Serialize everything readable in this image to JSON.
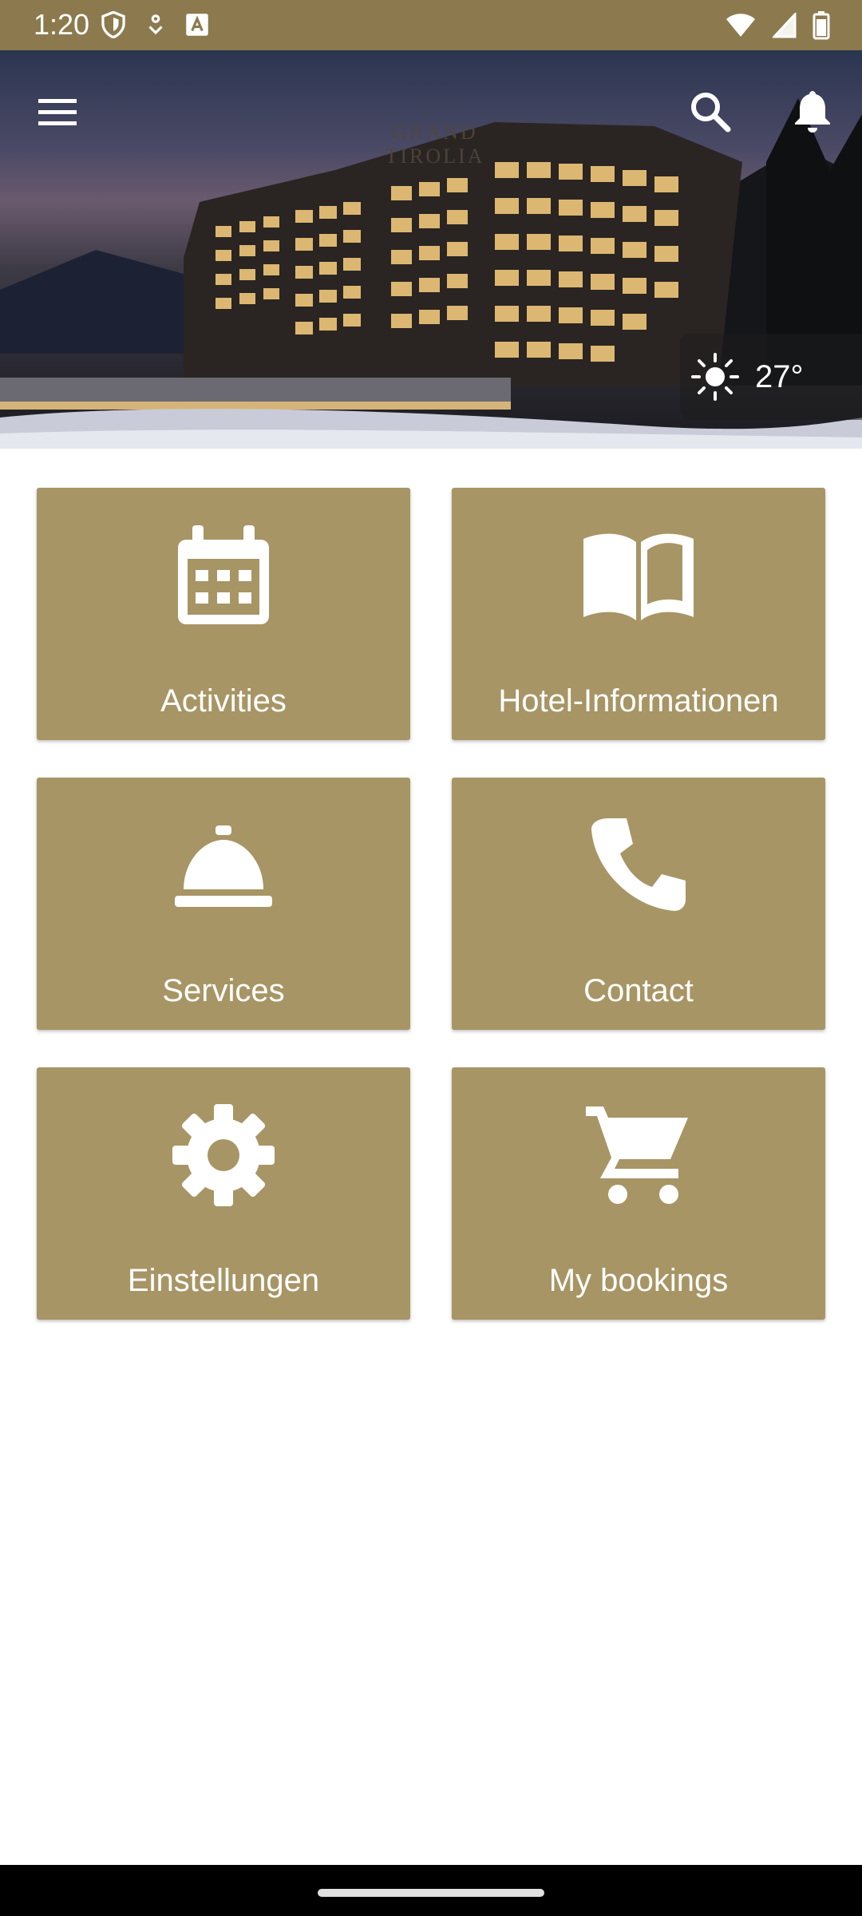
{
  "status_bar": {
    "time": "1:20"
  },
  "header": {
    "logo_text": "GRAND TIROLIA",
    "menu_icon": "hamburger-menu-icon",
    "search_icon": "search-icon",
    "notification_icon": "bell-icon"
  },
  "weather": {
    "icon": "sun-icon",
    "temperature": "27°"
  },
  "tiles": [
    {
      "label": "Activities",
      "icon": "calendar-icon"
    },
    {
      "label": "Hotel-Informationen",
      "icon": "book-icon"
    },
    {
      "label": "Services",
      "icon": "service-bell-icon"
    },
    {
      "label": "Contact",
      "icon": "phone-icon"
    },
    {
      "label": "Einstellungen",
      "icon": "gear-icon"
    },
    {
      "label": "My bookings",
      "icon": "cart-icon"
    }
  ],
  "colors": {
    "accent": "#a89565",
    "status_bar": "#8c7a4e",
    "background": "#ffffff"
  }
}
